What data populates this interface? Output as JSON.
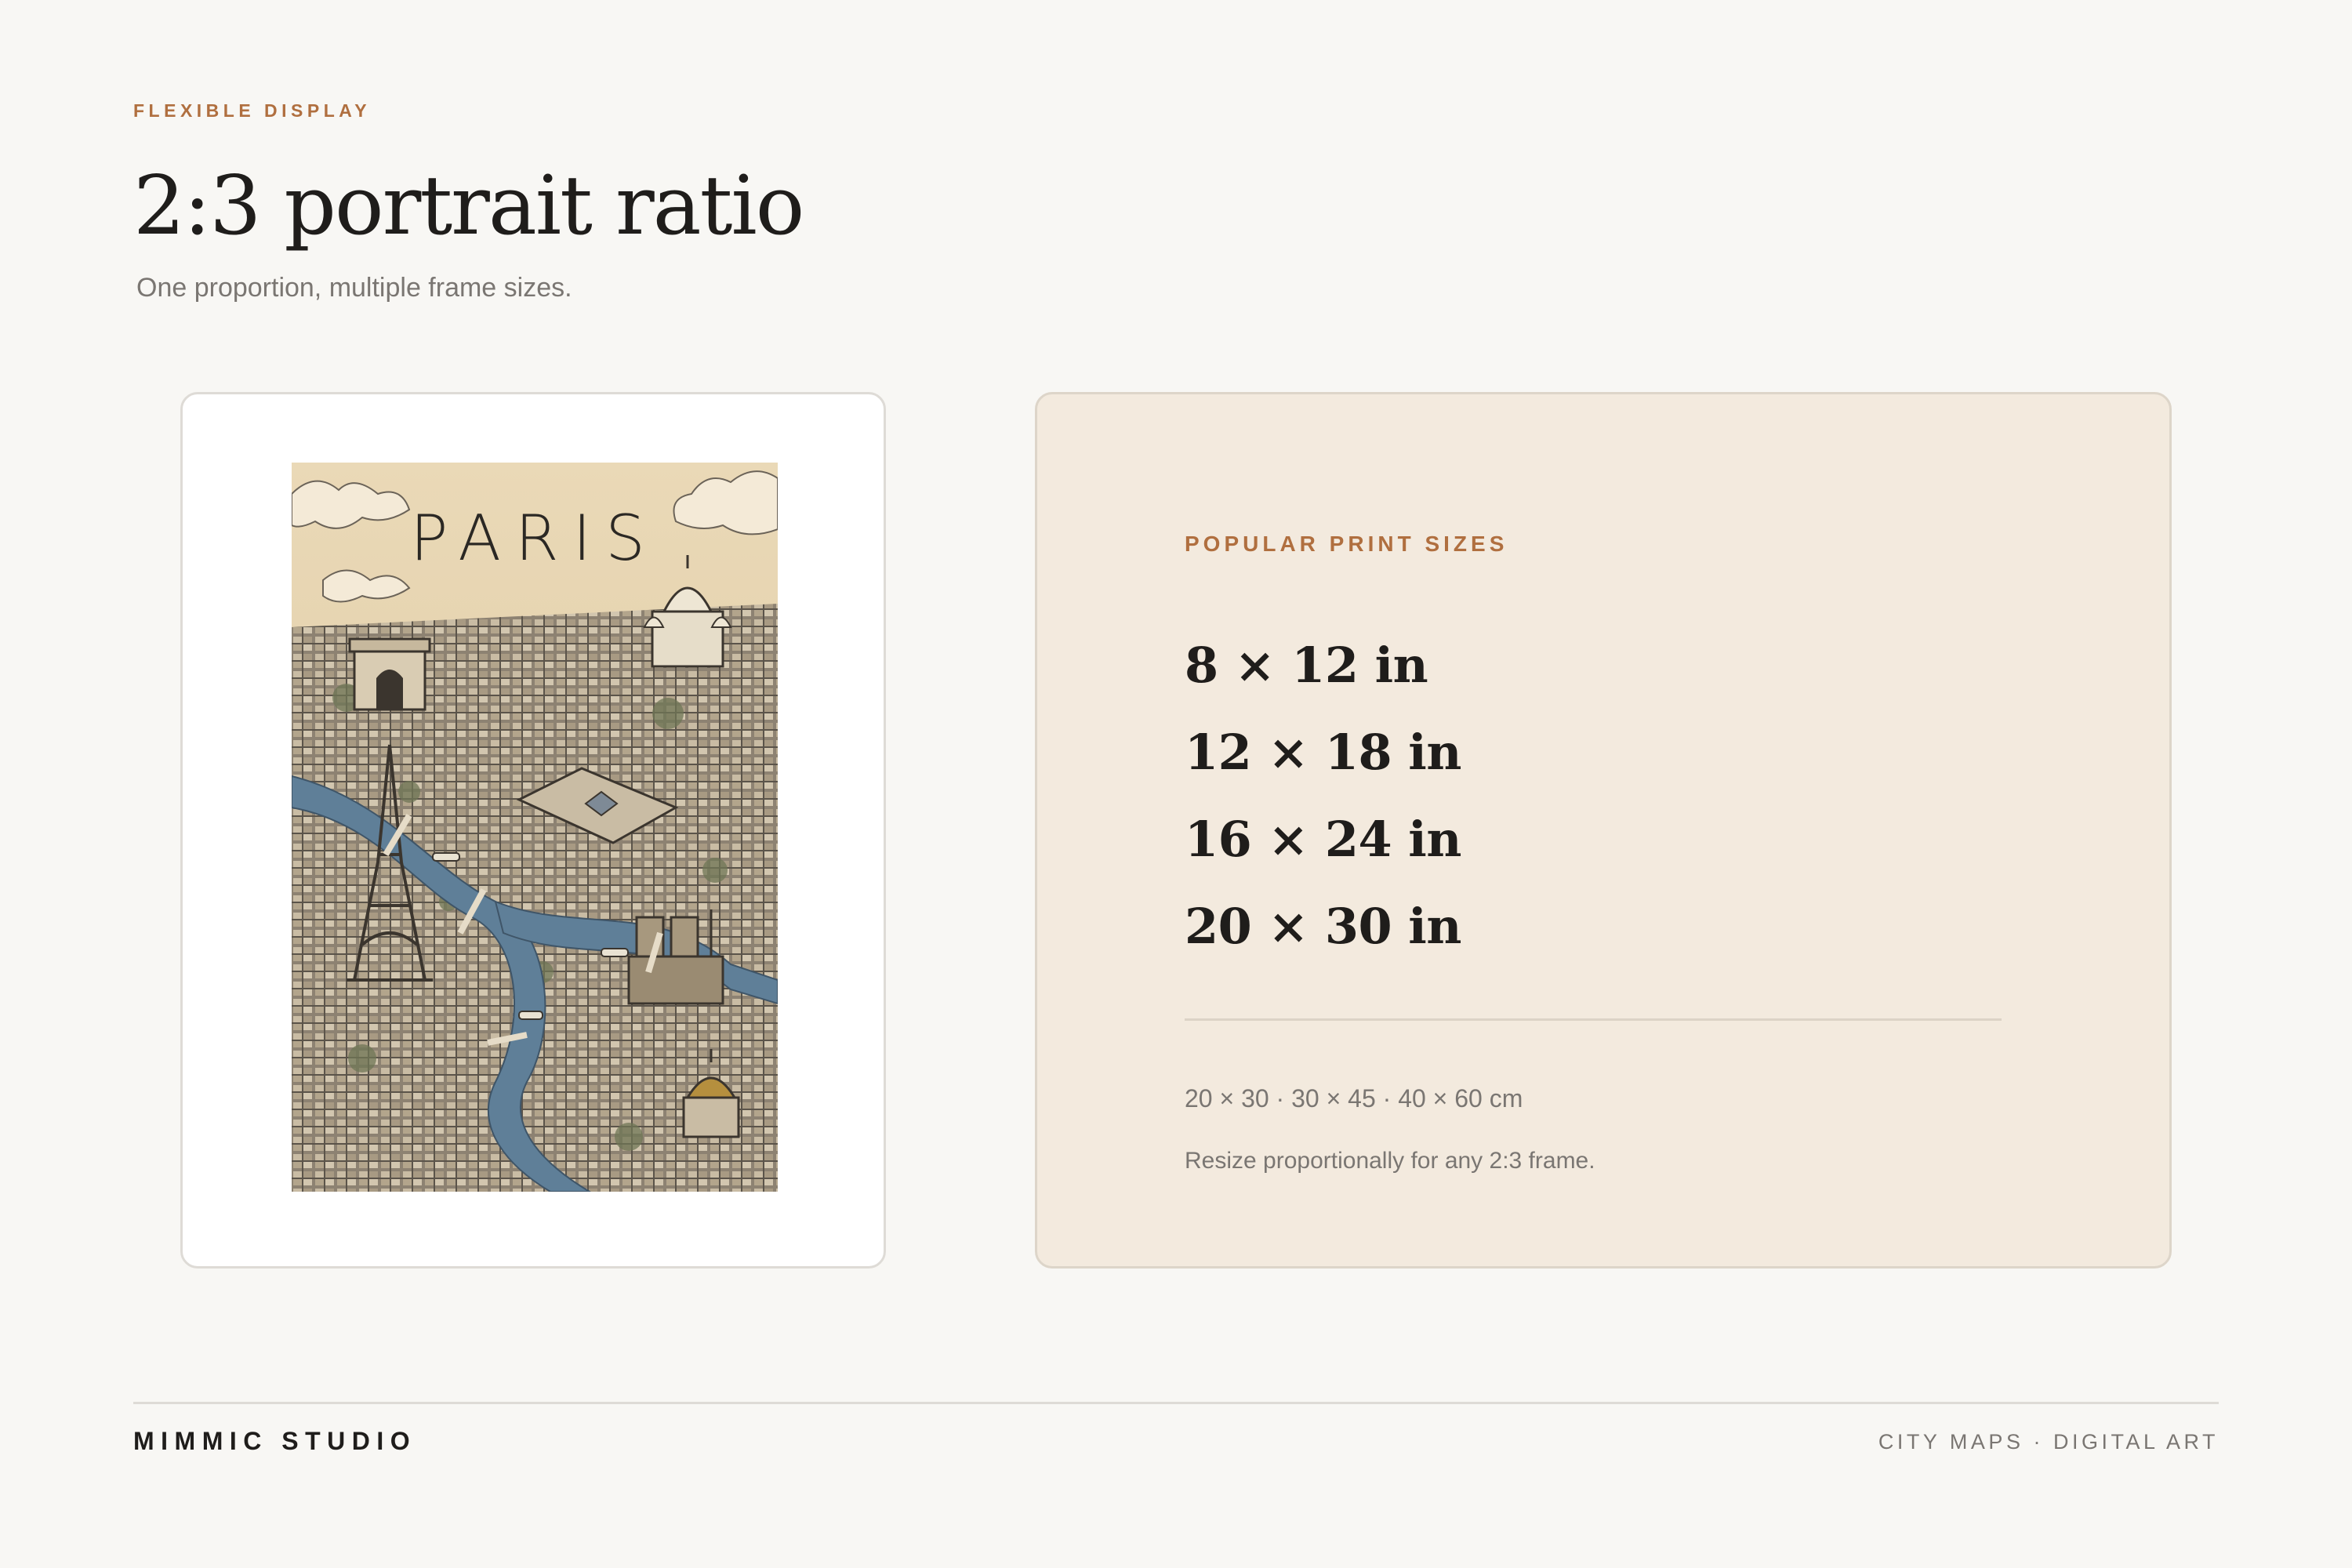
{
  "header": {
    "eyebrow": "FLEXIBLE DISPLAY",
    "title": "2:3 portrait ratio",
    "subtitle": "One proportion, multiple frame sizes."
  },
  "poster": {
    "title": "PARIS",
    "colors": {
      "paper": "#e8d8b8",
      "river": "#5f7f98",
      "ink": "#2b2824"
    }
  },
  "print_sizes": {
    "label": "POPULAR PRINT SIZES",
    "sizes": [
      "8 × 12 in",
      "12 × 18 in",
      "16 × 24 in",
      "20 × 30 in"
    ],
    "metric": "20 × 30 · 30 × 45 · 40 × 60 cm",
    "note": "Resize proportionally for any 2:3 frame."
  },
  "footer": {
    "brand": "MIMMIC STUDIO",
    "tagline": "CITY MAPS · DIGITAL ART"
  },
  "colors": {
    "background": "#f8f7f4",
    "accent": "#b06f3f",
    "card_tint": "#f3eade",
    "text": "#1f1d1b",
    "muted": "#7a7672"
  }
}
